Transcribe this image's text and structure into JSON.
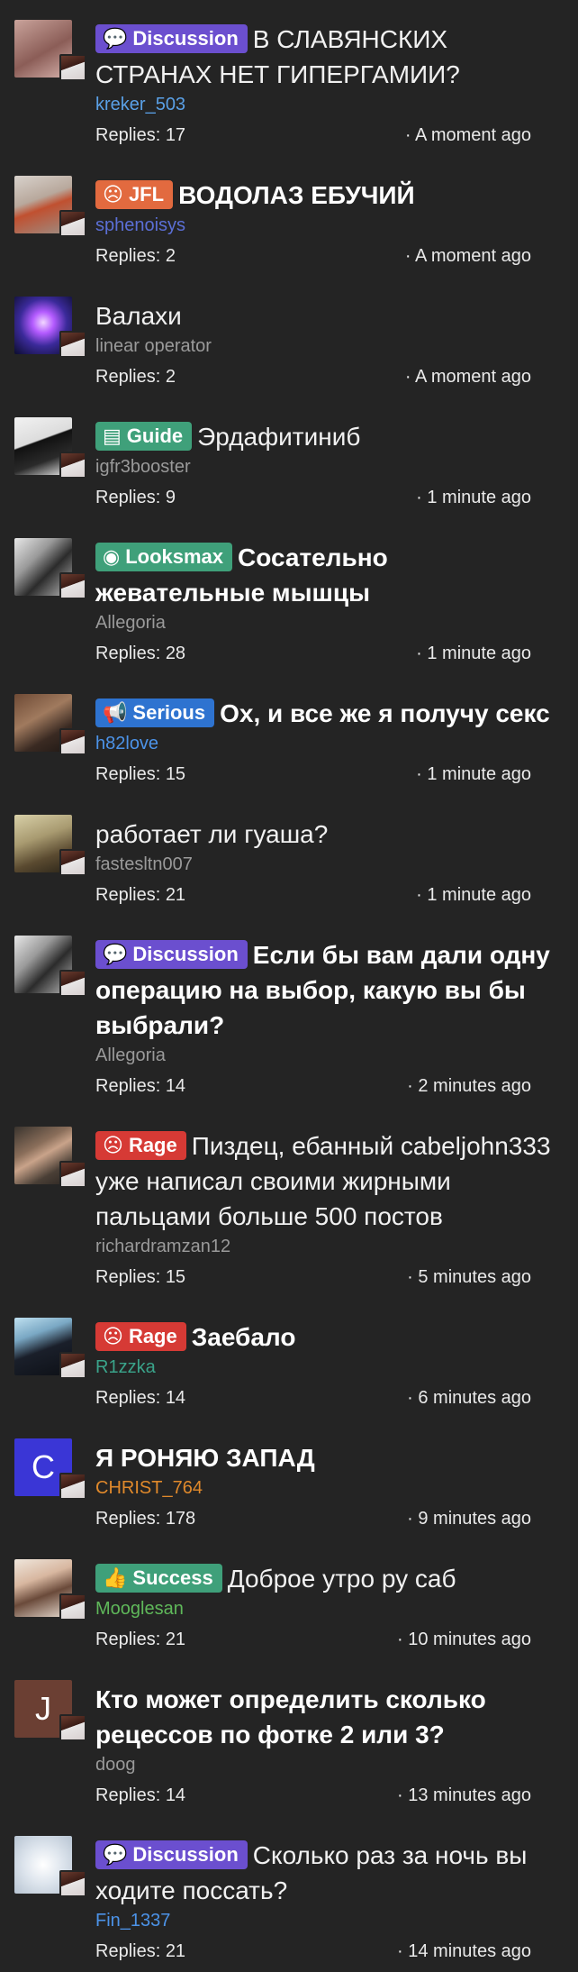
{
  "threads": [
    {
      "prefix": {
        "label": "Discussion",
        "icon": "chat-icon",
        "glyph": "💬",
        "color": "#6b4fcf"
      },
      "title": "В СЛАВЯНСКИХ СТРАНАХ НЕТ ГИПЕРГАМИИ?",
      "bold": false,
      "author": "kreker_503",
      "author_color": "#5aa0e6",
      "replies": "Replies: 17",
      "time": "· A moment ago",
      "avatar": {
        "type": "image",
        "bg": "linear-gradient(150deg,#c9a39b,#8b5d57 55%,#d7b3ad)"
      }
    },
    {
      "prefix": {
        "label": "JFL",
        "icon": "jfl-icon",
        "glyph": "☹",
        "color": "#e26a3f"
      },
      "title": "ВОДОЛАЗ ЕБУЧИЙ",
      "bold": true,
      "author": "sphenoisys",
      "author_color": "#5b6fd6",
      "replies": "Replies: 2",
      "time": "· A moment ago",
      "avatar": {
        "type": "image",
        "bg": "linear-gradient(160deg,#d8d2cc 0%,#b8a89c 40%,#c05030 55%,#9c8f86 100%)"
      }
    },
    {
      "prefix": null,
      "title": "Валахи",
      "bold": false,
      "author": "linear operator",
      "author_color": "#9a9a9a",
      "replies": "Replies: 2",
      "time": "· A moment ago",
      "avatar": {
        "type": "image",
        "bg": "radial-gradient(circle at 50% 45%,#f2d7ff 0%,#b45bff 25%,#3b2a9a 55%,#0b0d2e 100%)"
      }
    },
    {
      "prefix": {
        "label": "Guide",
        "icon": "book-icon",
        "glyph": "▤",
        "color": "#3fa07a"
      },
      "title": "Эрдафитиниб",
      "bold": false,
      "author": "igfr3booster",
      "author_color": "#9a9a9a",
      "replies": "Replies: 9",
      "time": "· 1 minute ago",
      "avatar": {
        "type": "image",
        "bg": "linear-gradient(160deg,#f2f2f2 0%,#dcdcdc 40%,#111 42%,#2a2a2a 70%,#eee 100%)"
      }
    },
    {
      "prefix": {
        "label": "Looksmax",
        "icon": "eye-icon",
        "glyph": "◉",
        "color": "#3fa07a"
      },
      "title": "Сосательно жевательные мышцы",
      "bold": true,
      "author": "Allegoria",
      "author_color": "#9a9a9a",
      "replies": "Replies: 28",
      "time": "· 1 minute ago",
      "avatar": {
        "type": "image",
        "bg": "linear-gradient(135deg,#e8e8e8 0%,#9a9a9a 35%,#2b2b2b 60%,#bdbdbd 100%)"
      }
    },
    {
      "prefix": {
        "label": "Serious",
        "icon": "megaphone-icon",
        "glyph": "📢",
        "color": "#2e73d0"
      },
      "title": "Ох, и все же я получу секс",
      "bold": true,
      "author": "h82love",
      "author_color": "#4c93e8",
      "replies": "Replies: 15",
      "time": "· 1 minute ago",
      "avatar": {
        "type": "image",
        "bg": "linear-gradient(150deg,#6e4a35 0%,#a07a5e 40%,#3a2a22 70%,#1e1714 100%)"
      }
    },
    {
      "prefix": null,
      "title": "работает ли гуаша?",
      "bold": false,
      "author": "fastesltn007",
      "author_color": "#9a9a9a",
      "replies": "Replies: 21",
      "time": "· 1 minute ago",
      "avatar": {
        "type": "image",
        "bg": "linear-gradient(160deg,#d8d0a8 0%,#a89a70 40%,#5a4a30 70%,#2a2418 100%)"
      }
    },
    {
      "prefix": {
        "label": "Discussion",
        "icon": "chat-icon",
        "glyph": "💬",
        "color": "#6b4fcf"
      },
      "title": "Если бы вам дали одну операцию на выбор, какую вы бы выбрали?",
      "bold": true,
      "author": "Allegoria",
      "author_color": "#9a9a9a",
      "replies": "Replies: 14",
      "time": "· 2 minutes ago",
      "avatar": {
        "type": "image",
        "bg": "linear-gradient(135deg,#e8e8e8 0%,#9a9a9a 35%,#2b2b2b 60%,#bdbdbd 100%)"
      }
    },
    {
      "prefix": {
        "label": "Rage",
        "icon": "angry-face-icon",
        "glyph": "☹",
        "color": "#d63a35"
      },
      "title": "Пиздец, ебанный cabeljohn333 уже написал своими жирными пальцами больше 500 постов",
      "bold": false,
      "author": "richardramzan12",
      "author_color": "#9a9a9a",
      "replies": "Replies: 15",
      "time": "· 5 minutes ago",
      "avatar": {
        "type": "image",
        "bg": "linear-gradient(150deg,#3a342e 0%,#8a6e5a 35%,#c9a38a 50%,#4a3f36 75%,#2a2420 100%)"
      }
    },
    {
      "prefix": {
        "label": "Rage",
        "icon": "angry-face-icon",
        "glyph": "☹",
        "color": "#d63a35"
      },
      "title": "Заебало",
      "bold": true,
      "author": "R1zzka",
      "author_color": "#3aa38a",
      "replies": "Replies: 14",
      "time": "· 6 minutes ago",
      "avatar": {
        "type": "image",
        "bg": "linear-gradient(160deg,#bfe0f0 0%,#7aa8c4 30%,#1a1f2a 55%,#0d1016 100%)"
      }
    },
    {
      "prefix": null,
      "title": "Я РОНЯЮ ЗАПАД",
      "bold": true,
      "author": "CHRIST_764",
      "author_color": "#e0892b",
      "replies": "Replies: 178",
      "time": "· 9 minutes ago",
      "avatar": {
        "type": "letter",
        "letter": "C",
        "bg": "#3a36d6"
      }
    },
    {
      "prefix": {
        "label": "Success",
        "icon": "thumbs-up-icon",
        "glyph": "👍",
        "color": "#3fa07a"
      },
      "title": "Доброе утро ру саб",
      "bold": false,
      "author": "Mooglesan",
      "author_color": "#5fb85a",
      "replies": "Replies: 21",
      "time": "· 10 minutes ago",
      "avatar": {
        "type": "image",
        "bg": "linear-gradient(160deg,#efe6dc 0%,#d8b7a0 35%,#6a4a3a 60%,#e9ddd2 100%)"
      }
    },
    {
      "prefix": null,
      "title": "Кто может определить сколько рецессов по фотке 2 или 3?",
      "bold": true,
      "author": "doog",
      "author_color": "#9a9a9a",
      "replies": "Replies: 14",
      "time": "· 13 minutes ago",
      "avatar": {
        "type": "letter",
        "letter": "J",
        "bg": "#6b3f33"
      }
    },
    {
      "prefix": {
        "label": "Discussion",
        "icon": "chat-icon",
        "glyph": "💬",
        "color": "#6b4fcf"
      },
      "title": "Сколько раз за ночь вы ходите поссать?",
      "bold": false,
      "author": "Fin_1337",
      "author_color": "#4c93e8",
      "replies": "Replies: 21",
      "time": "· 14 minutes ago",
      "avatar": {
        "type": "image",
        "bg": "radial-gradient(circle at 50% 50%,#ffffff 0%,#dfe6ee 45%,#b7c4d2 100%)"
      }
    }
  ]
}
